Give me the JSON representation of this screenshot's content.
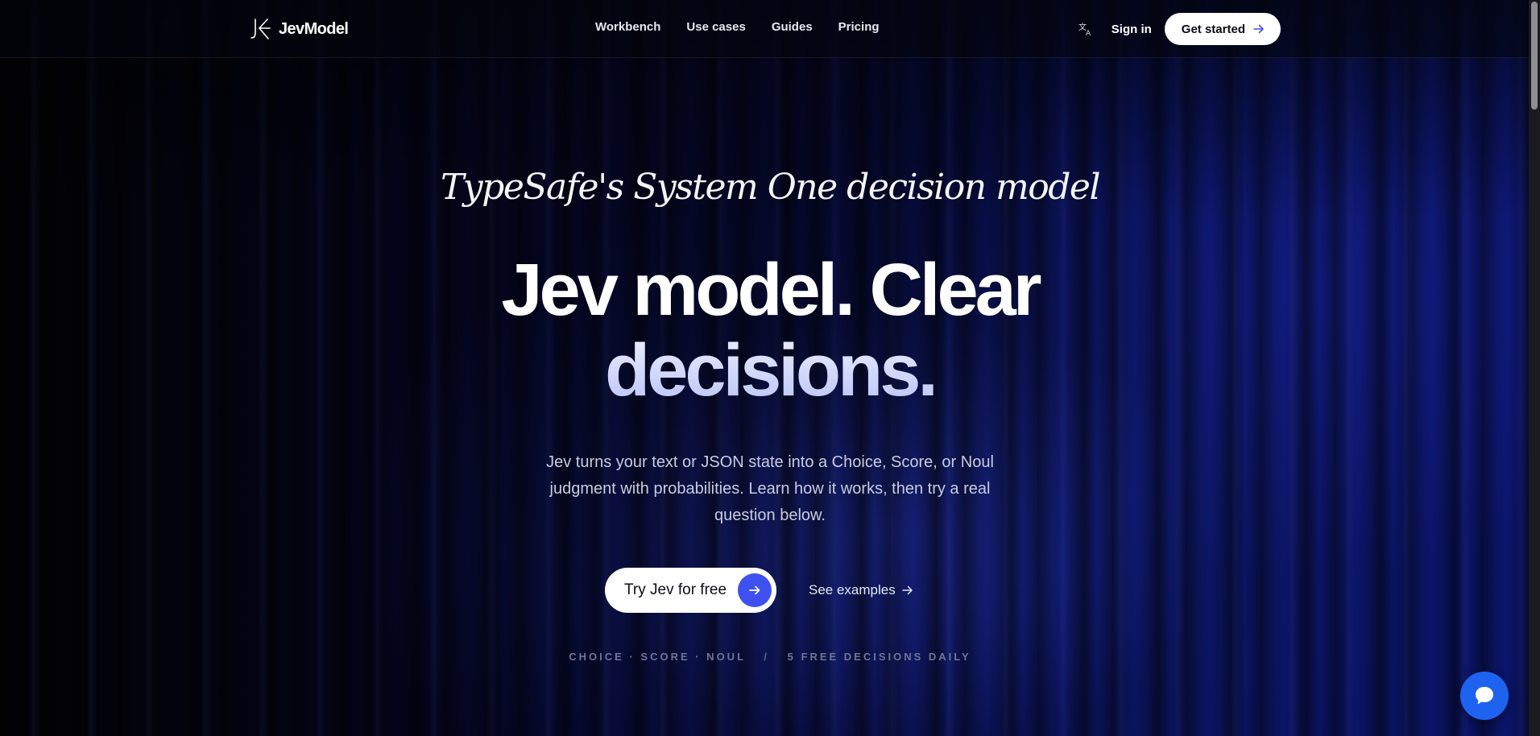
{
  "nav": {
    "brand": "JevModel",
    "links": [
      "Workbench",
      "Use cases",
      "Guides",
      "Pricing"
    ],
    "signin": "Sign in",
    "get_started": "Get started"
  },
  "hero": {
    "tagline": "TypeSafe's System One decision model",
    "headline_line1": "Jev model. Clear",
    "headline_line2": "decisions.",
    "subtext": "Jev turns your text or JSON state into a Choice, Score, or Noul judgment with probabilities. Learn how it works, then try a real question below.",
    "cta_primary": "Try Jev for free",
    "cta_secondary": "See examples",
    "footnote_left": "CHOICE · SCORE · NOUL",
    "footnote_sep": "/",
    "footnote_right": "5 FREE DECISIONS DAILY"
  },
  "icons": {
    "translate": "translate-icon",
    "arrow": "arrow-right-icon",
    "chat": "chat-bubble-icon"
  },
  "colors": {
    "accent": "#3e51f0",
    "chat": "#1e63f0",
    "background": "#060a3a"
  }
}
